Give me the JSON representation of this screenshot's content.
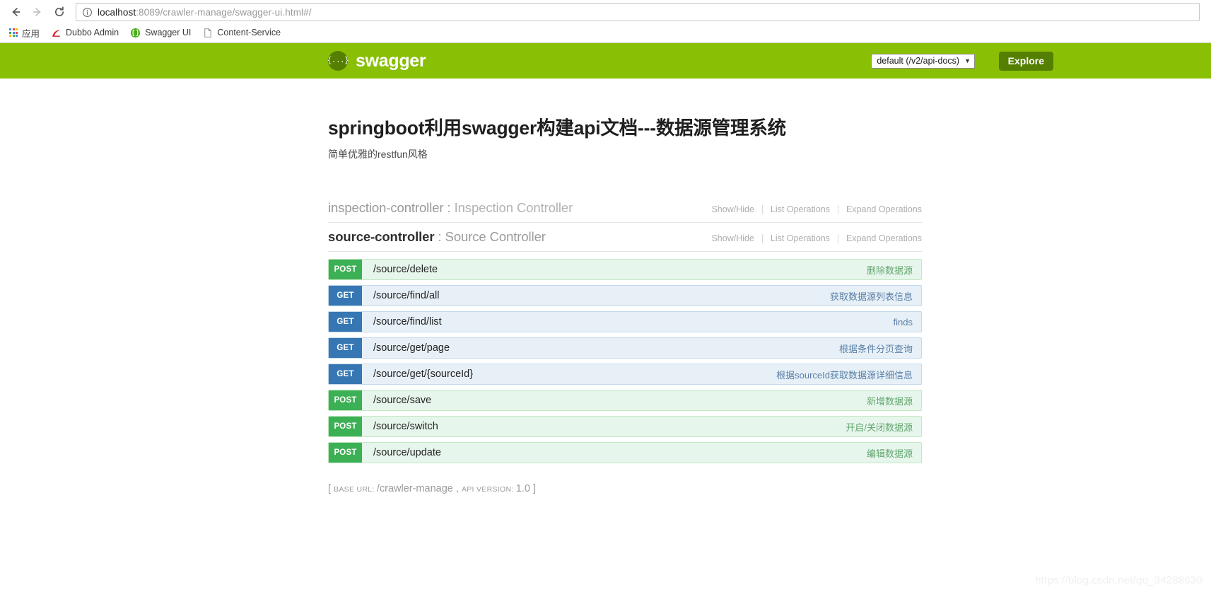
{
  "browser": {
    "back_label": "Back",
    "forward_label": "Forward",
    "reload_label": "Reload",
    "url_host": "localhost",
    "url_rest": ":8089/crawler-manage/swagger-ui.html#/",
    "url_full": "localhost:8089/crawler-manage/swagger-ui.html#/",
    "info_icon": "info-circle-icon",
    "bookmarks": [
      {
        "label": "应用",
        "icon": "apps-grid-icon"
      },
      {
        "label": "Dubbo Admin",
        "icon": "dubbo-logo-icon"
      },
      {
        "label": "Swagger UI",
        "icon": "swagger-logo-icon"
      },
      {
        "label": "Content-Service",
        "icon": "page-document-icon"
      }
    ]
  },
  "header": {
    "logo_glyph": "{...}",
    "logo_text": "swagger",
    "api_select_value": "default (/v2/api-docs)",
    "caret": "▼",
    "explore_label": "Explore",
    "bar_color": "#89bf04",
    "logo_circle_color": "#547f00",
    "explore_color": "#547f00"
  },
  "doc": {
    "title": "springboot利用swagger构建api文档---数据源管理系统",
    "subtitle": "简单优雅的restfun风格"
  },
  "resource_links": {
    "show_hide": "Show/Hide",
    "list_operations": "List Operations",
    "expand_operations": "Expand Operations"
  },
  "resources": [
    {
      "id": "inspection-controller",
      "separator": " : ",
      "description": "Inspection Controller",
      "active": false,
      "operations": []
    },
    {
      "id": "source-controller",
      "separator": " : ",
      "description": "Source Controller",
      "active": true,
      "operations": [
        {
          "method": "POST",
          "path": "/source/delete",
          "description": "删除数据源"
        },
        {
          "method": "GET",
          "path": "/source/find/all",
          "description": "获取数据源列表信息"
        },
        {
          "method": "GET",
          "path": "/source/find/list",
          "description": "finds"
        },
        {
          "method": "GET",
          "path": "/source/get/page",
          "description": "根据条件分页查询"
        },
        {
          "method": "GET",
          "path": "/source/get/{sourceId}",
          "description": "根据sourceId获取数据源详细信息"
        },
        {
          "method": "POST",
          "path": "/source/save",
          "description": "新增数据源"
        },
        {
          "method": "POST",
          "path": "/source/switch",
          "description": "开启/关闭数据源"
        },
        {
          "method": "POST",
          "path": "/source/update",
          "description": "编辑数据源"
        }
      ]
    }
  ],
  "footer": {
    "open_bracket": "[",
    "base_url_label": "BASE URL",
    "base_url_sep": ": ",
    "base_url_value": "/crawler-manage",
    "comma": " , ",
    "api_version_label": "API VERSION",
    "api_version_sep": ": ",
    "api_version_value": "1.0",
    "close_bracket": "]"
  },
  "watermark": "https://blog.csdn.net/qq_34288630",
  "colors": {
    "get_badge": "#3677b3",
    "post_badge": "#3cb054",
    "get_row_bg": "#e7f0f7",
    "post_row_bg": "#e7f6ec",
    "swagger_green": "#89bf04"
  }
}
